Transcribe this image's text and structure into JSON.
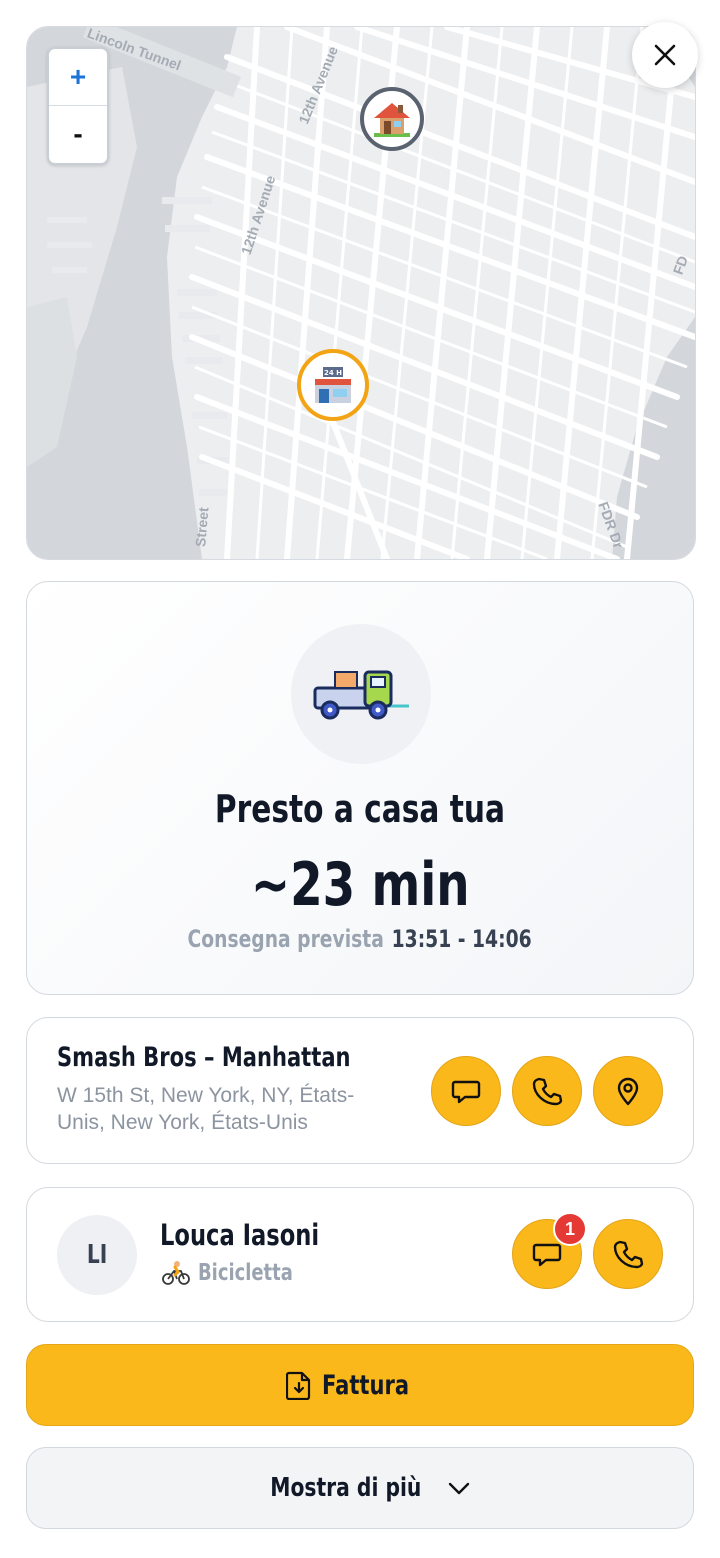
{
  "map": {
    "zoom_in": "+",
    "zoom_out": "-",
    "streets": [
      "Lincoln Tunnel",
      "12th Avenue",
      "12th Avenue",
      "Street",
      "FDR Dr",
      "FD"
    ]
  },
  "eta": {
    "title": "Presto a casa tua",
    "time": "~23 min",
    "window_label": "Consegna prevista",
    "window_value": "13:51 - 14:06"
  },
  "restaurant": {
    "name": "Smash Bros – Manhattan",
    "address": "W 15th St, New York, NY, États-Unis, New York, États-Unis",
    "icons": [
      "chat-icon",
      "phone-icon",
      "location-pin-icon"
    ]
  },
  "courier": {
    "initials": "LI",
    "name": "Louca Iasoni",
    "vehicle": "Bicicletta",
    "unread": "1",
    "icons": [
      "chat-icon",
      "phone-icon"
    ]
  },
  "actions": {
    "invoice": "Fattura",
    "show_more": "Mostra di più"
  },
  "colors": {
    "accent": "#fbb81b",
    "badge": "#e53935",
    "text": "#111827",
    "muted": "#9aa3b0"
  }
}
